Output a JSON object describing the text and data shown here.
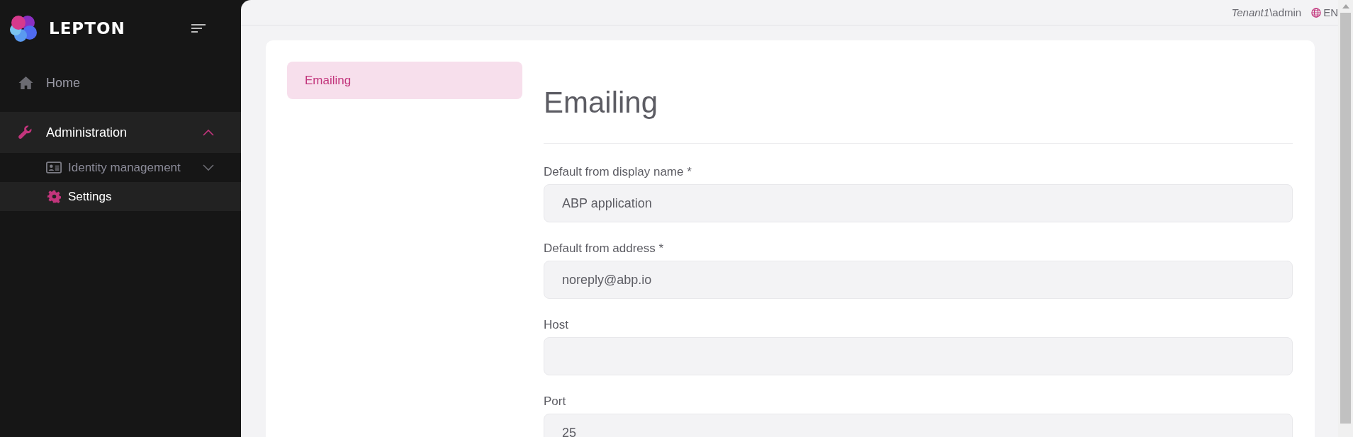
{
  "brand": {
    "name": "LEPTON"
  },
  "sidebar": {
    "items": [
      {
        "label": "Home",
        "selected": false
      },
      {
        "label": "Administration",
        "expanded": true,
        "selected": true,
        "children": [
          {
            "label": "Identity management",
            "expanded": false,
            "selected": false
          },
          {
            "label": "Settings",
            "selected": true
          }
        ]
      }
    ]
  },
  "topbar": {
    "tenant": "Tenant1",
    "user": "\\admin",
    "language": "EN"
  },
  "settings_nav": [
    {
      "label": "Emailing",
      "selected": true
    }
  ],
  "form": {
    "title": "Emailing",
    "fields": [
      {
        "label": "Default from display name *",
        "value": "ABP application"
      },
      {
        "label": "Default from address *",
        "value": "noreply@abp.io"
      },
      {
        "label": "Host"
      },
      {
        "label": "Port",
        "value": "25"
      }
    ]
  }
}
